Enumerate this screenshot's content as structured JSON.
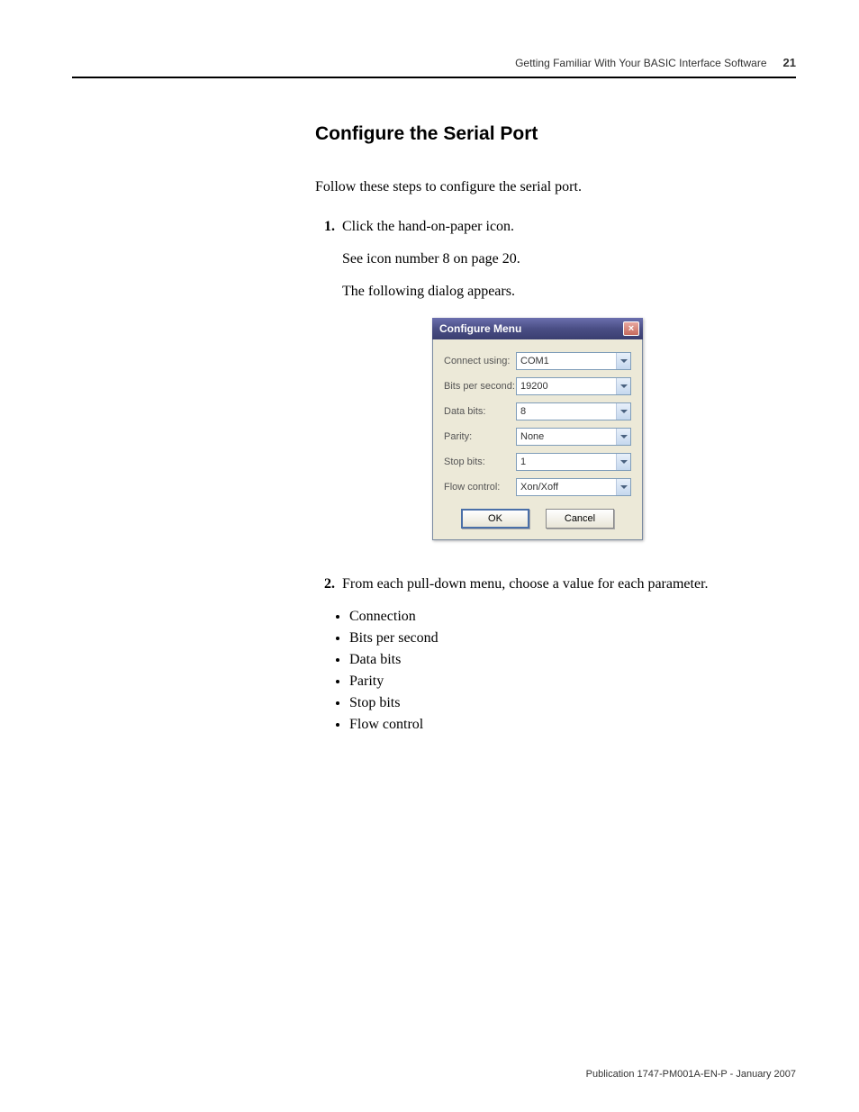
{
  "header": {
    "running_title": "Getting Familiar With Your BASIC Interface Software",
    "page_number": "21"
  },
  "section": {
    "title": "Configure the Serial Port",
    "intro": "Follow these steps to configure the serial port."
  },
  "steps": {
    "s1": {
      "num": "1.",
      "text": "Click the hand-on-paper icon.",
      "sub1": "See icon number 8 on page 20.",
      "sub2": "The following dialog appears."
    },
    "s2": {
      "num": "2.",
      "text": "From each pull-down menu, choose a value for each parameter."
    }
  },
  "dialog": {
    "title": "Configure Menu",
    "close_glyph": "×",
    "rows": {
      "connect": {
        "label": "Connect using:",
        "value": "COM1"
      },
      "bps": {
        "label": "Bits per second:",
        "value": "19200"
      },
      "databits": {
        "label": "Data bits:",
        "value": "8"
      },
      "parity": {
        "label": "Parity:",
        "value": "None"
      },
      "stopbits": {
        "label": "Stop bits:",
        "value": "1"
      },
      "flow": {
        "label": "Flow control:",
        "value": "Xon/Xoff"
      }
    },
    "ok": "OK",
    "cancel": "Cancel"
  },
  "bullets": {
    "b1": "Connection",
    "b2": "Bits per second",
    "b3": "Data bits",
    "b4": "Parity",
    "b5": "Stop bits",
    "b6": "Flow control"
  },
  "footer": "Publication 1747-PM001A-EN-P - January 2007"
}
